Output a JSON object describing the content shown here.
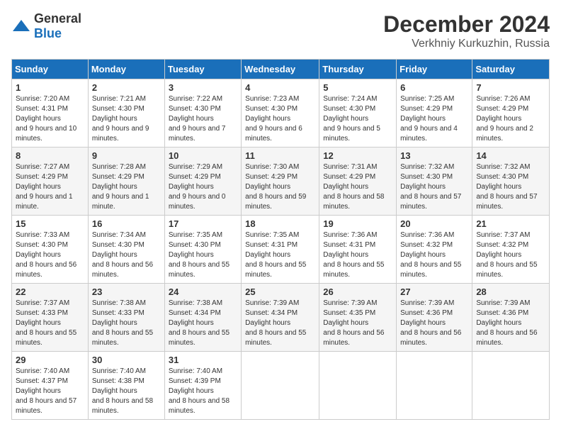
{
  "header": {
    "logo_general": "General",
    "logo_blue": "Blue",
    "month_title": "December 2024",
    "location": "Verkhniy Kurkuzhin, Russia"
  },
  "days_of_week": [
    "Sunday",
    "Monday",
    "Tuesday",
    "Wednesday",
    "Thursday",
    "Friday",
    "Saturday"
  ],
  "weeks": [
    [
      {
        "day": "1",
        "sunrise": "7:20 AM",
        "sunset": "4:31 PM",
        "daylight": "9 hours and 10 minutes."
      },
      {
        "day": "2",
        "sunrise": "7:21 AM",
        "sunset": "4:30 PM",
        "daylight": "9 hours and 9 minutes."
      },
      {
        "day": "3",
        "sunrise": "7:22 AM",
        "sunset": "4:30 PM",
        "daylight": "9 hours and 7 minutes."
      },
      {
        "day": "4",
        "sunrise": "7:23 AM",
        "sunset": "4:30 PM",
        "daylight": "9 hours and 6 minutes."
      },
      {
        "day": "5",
        "sunrise": "7:24 AM",
        "sunset": "4:30 PM",
        "daylight": "9 hours and 5 minutes."
      },
      {
        "day": "6",
        "sunrise": "7:25 AM",
        "sunset": "4:29 PM",
        "daylight": "9 hours and 4 minutes."
      },
      {
        "day": "7",
        "sunrise": "7:26 AM",
        "sunset": "4:29 PM",
        "daylight": "9 hours and 2 minutes."
      }
    ],
    [
      {
        "day": "8",
        "sunrise": "7:27 AM",
        "sunset": "4:29 PM",
        "daylight": "9 hours and 1 minute."
      },
      {
        "day": "9",
        "sunrise": "7:28 AM",
        "sunset": "4:29 PM",
        "daylight": "9 hours and 1 minute."
      },
      {
        "day": "10",
        "sunrise": "7:29 AM",
        "sunset": "4:29 PM",
        "daylight": "9 hours and 0 minutes."
      },
      {
        "day": "11",
        "sunrise": "7:30 AM",
        "sunset": "4:29 PM",
        "daylight": "8 hours and 59 minutes."
      },
      {
        "day": "12",
        "sunrise": "7:31 AM",
        "sunset": "4:29 PM",
        "daylight": "8 hours and 58 minutes."
      },
      {
        "day": "13",
        "sunrise": "7:32 AM",
        "sunset": "4:30 PM",
        "daylight": "8 hours and 57 minutes."
      },
      {
        "day": "14",
        "sunrise": "7:32 AM",
        "sunset": "4:30 PM",
        "daylight": "8 hours and 57 minutes."
      }
    ],
    [
      {
        "day": "15",
        "sunrise": "7:33 AM",
        "sunset": "4:30 PM",
        "daylight": "8 hours and 56 minutes."
      },
      {
        "day": "16",
        "sunrise": "7:34 AM",
        "sunset": "4:30 PM",
        "daylight": "8 hours and 56 minutes."
      },
      {
        "day": "17",
        "sunrise": "7:35 AM",
        "sunset": "4:30 PM",
        "daylight": "8 hours and 55 minutes."
      },
      {
        "day": "18",
        "sunrise": "7:35 AM",
        "sunset": "4:31 PM",
        "daylight": "8 hours and 55 minutes."
      },
      {
        "day": "19",
        "sunrise": "7:36 AM",
        "sunset": "4:31 PM",
        "daylight": "8 hours and 55 minutes."
      },
      {
        "day": "20",
        "sunrise": "7:36 AM",
        "sunset": "4:32 PM",
        "daylight": "8 hours and 55 minutes."
      },
      {
        "day": "21",
        "sunrise": "7:37 AM",
        "sunset": "4:32 PM",
        "daylight": "8 hours and 55 minutes."
      }
    ],
    [
      {
        "day": "22",
        "sunrise": "7:37 AM",
        "sunset": "4:33 PM",
        "daylight": "8 hours and 55 minutes."
      },
      {
        "day": "23",
        "sunrise": "7:38 AM",
        "sunset": "4:33 PM",
        "daylight": "8 hours and 55 minutes."
      },
      {
        "day": "24",
        "sunrise": "7:38 AM",
        "sunset": "4:34 PM",
        "daylight": "8 hours and 55 minutes."
      },
      {
        "day": "25",
        "sunrise": "7:39 AM",
        "sunset": "4:34 PM",
        "daylight": "8 hours and 55 minutes."
      },
      {
        "day": "26",
        "sunrise": "7:39 AM",
        "sunset": "4:35 PM",
        "daylight": "8 hours and 56 minutes."
      },
      {
        "day": "27",
        "sunrise": "7:39 AM",
        "sunset": "4:36 PM",
        "daylight": "8 hours and 56 minutes."
      },
      {
        "day": "28",
        "sunrise": "7:39 AM",
        "sunset": "4:36 PM",
        "daylight": "8 hours and 56 minutes."
      }
    ],
    [
      {
        "day": "29",
        "sunrise": "7:40 AM",
        "sunset": "4:37 PM",
        "daylight": "8 hours and 57 minutes."
      },
      {
        "day": "30",
        "sunrise": "7:40 AM",
        "sunset": "4:38 PM",
        "daylight": "8 hours and 58 minutes."
      },
      {
        "day": "31",
        "sunrise": "7:40 AM",
        "sunset": "4:39 PM",
        "daylight": "8 hours and 58 minutes."
      },
      null,
      null,
      null,
      null
    ]
  ]
}
